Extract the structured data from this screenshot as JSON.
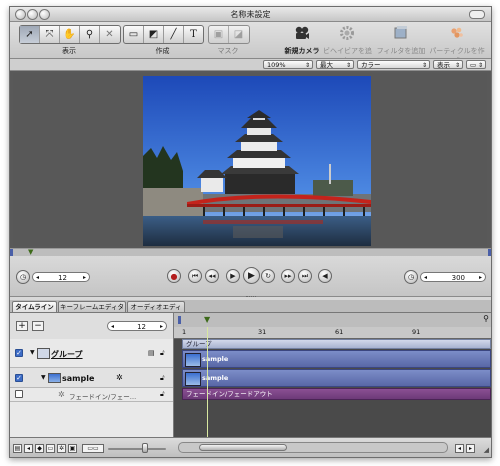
{
  "window": {
    "title": "名称未設定"
  },
  "toolbar": {
    "groups": [
      {
        "label": "表示"
      },
      {
        "label": "作成"
      },
      {
        "label": "マスク"
      }
    ],
    "actions": [
      {
        "label": "新規カメラ"
      },
      {
        "label": "ビヘイビアを追加"
      },
      {
        "label": "フィルタを追加"
      },
      {
        "label": "パーティクルを作成"
      }
    ]
  },
  "canvas_bar": {
    "zoom": "109%",
    "resolution": "最大",
    "channel": "カラー",
    "view": "表示"
  },
  "transport": {
    "current_frame": "12",
    "end_frame": "300"
  },
  "tabs": [
    {
      "label": "タイムライン"
    },
    {
      "label": "キーフレームエディタ"
    },
    {
      "label": "オーディオエディタ"
    }
  ],
  "timeline": {
    "frame_field": "12",
    "ruler": [
      "1",
      "31",
      "61",
      "91"
    ],
    "layers": [
      {
        "name": "グループ"
      },
      {
        "name": "sample"
      },
      {
        "name": "フェードイン/フェー…"
      }
    ],
    "bars": {
      "group": "グループ",
      "sample1": "sample",
      "sample2": "sample",
      "fade": "フェードイン/フェードアウト"
    }
  }
}
